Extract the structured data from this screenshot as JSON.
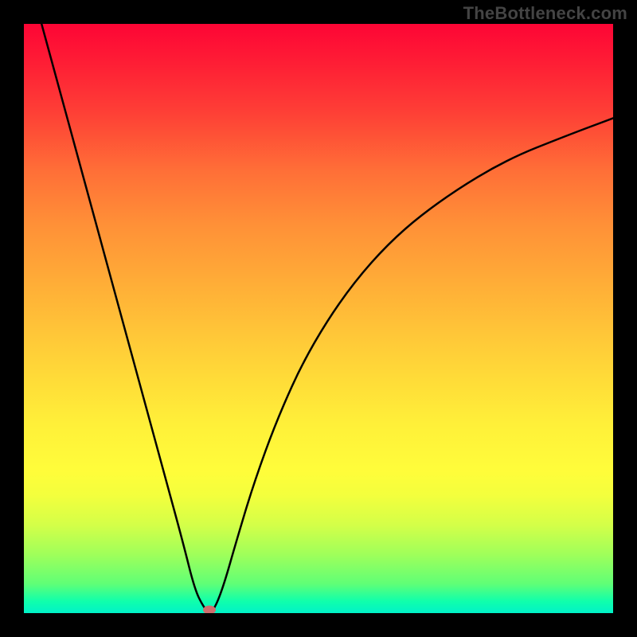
{
  "watermark": "TheBottleneck.com",
  "chart_data": {
    "type": "line",
    "title": "",
    "xlabel": "",
    "ylabel": "",
    "xlim": [
      0,
      100
    ],
    "ylim": [
      0,
      100
    ],
    "x": [
      3,
      6,
      9,
      12,
      15,
      18,
      21,
      24,
      27,
      29,
      30.5,
      31.5,
      32.5,
      34,
      36,
      39,
      43,
      48,
      55,
      63,
      72,
      82,
      92,
      100
    ],
    "values": [
      100,
      89,
      78,
      67,
      56,
      45,
      34,
      23,
      12,
      4,
      1,
      0,
      1,
      5,
      12,
      22,
      33,
      44,
      55,
      64,
      71,
      77,
      81,
      84
    ],
    "marker": {
      "x": 31.5,
      "y": 0.5
    },
    "colors": {
      "curve": "#000000",
      "marker": "#cf6e6e",
      "gradient_top": "#fd0535",
      "gradient_bottom": "#00f2c8",
      "frame": "#000000"
    }
  }
}
